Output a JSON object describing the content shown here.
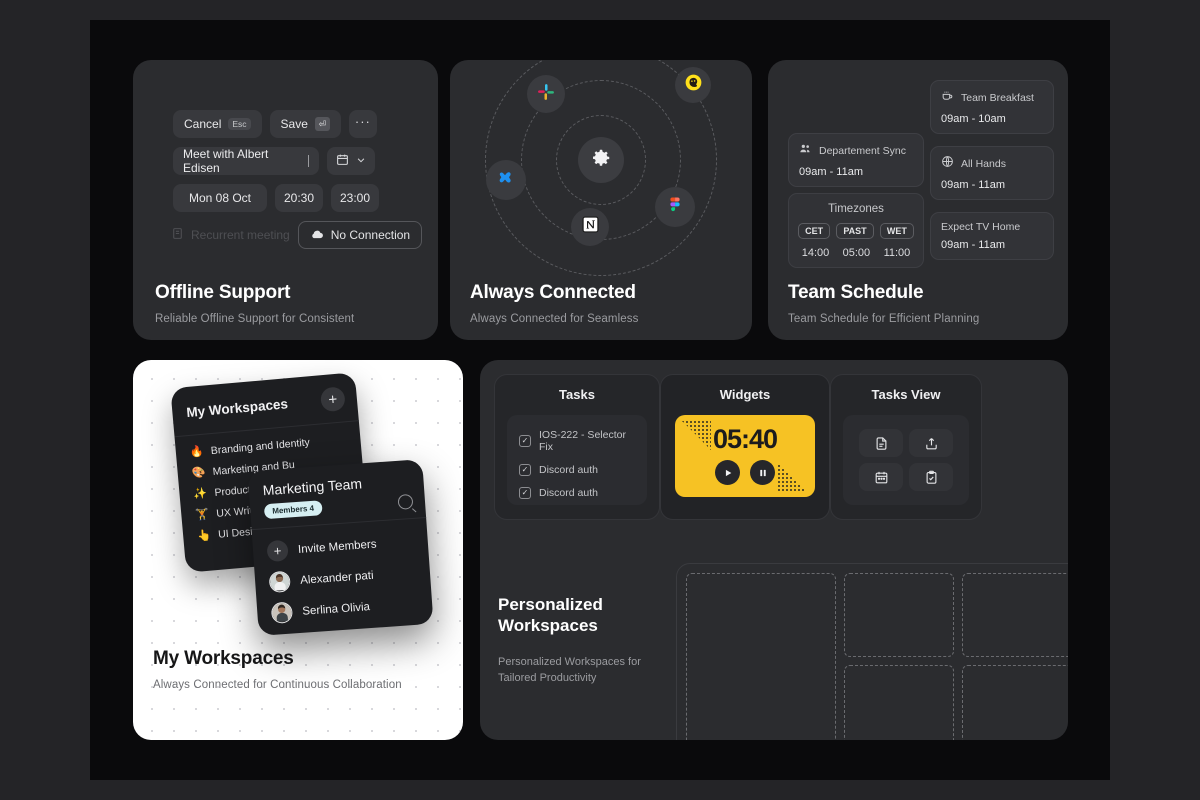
{
  "cards": {
    "offline": {
      "title": "Offline Support",
      "subtitle": "Reliable Offline Support for Consistent",
      "cancel_label": "Cancel",
      "cancel_key": "Esc",
      "save_label": "Save",
      "more_label": "···",
      "meeting_title": "Meet with Albert Edisen",
      "date": "Mon 08 Oct",
      "time_start": "20:30",
      "time_end": "23:00",
      "recurrent_label": "Recurrent meeting",
      "connection_label": "No Connection"
    },
    "connected": {
      "title": "Always Connected",
      "subtitle": "Always Connected for Seamless",
      "integrations": [
        {
          "name": "slack",
          "label": "Slack"
        },
        {
          "name": "mailchimp",
          "label": "Mailchimp"
        },
        {
          "name": "xero",
          "label": "Xero"
        },
        {
          "name": "notion",
          "label": "Notion"
        },
        {
          "name": "figma",
          "label": "Figma"
        },
        {
          "name": "settings",
          "label": "Settings"
        }
      ]
    },
    "schedule": {
      "title": "Team Schedule",
      "subtitle": "Team Schedule for Efficient Planning",
      "events": [
        {
          "name": "Departement Sync",
          "time": "09am - 11am",
          "icon": "users-icon"
        },
        {
          "name": "Team Breakfast",
          "time": "09am - 10am",
          "icon": "coffee-icon"
        },
        {
          "name": "All Hands",
          "time": "09am - 11am",
          "icon": "globe-icon"
        },
        {
          "name": "Expect TV Home",
          "time": "09am - 11am",
          "icon": "none"
        }
      ],
      "timezones": {
        "title": "Timezones",
        "tags": [
          "CET",
          "PAST",
          "WET"
        ],
        "times": [
          "14:00",
          "05:00",
          "11:00"
        ]
      }
    },
    "workspaces": {
      "title": "My Workspaces",
      "subtitle": "Always Connected for Continuous Collaboration",
      "panel_title": "My Workspaces",
      "add_label": "+",
      "items": [
        {
          "emoji": "🔥",
          "label": "Branding and Identity"
        },
        {
          "emoji": "🎨",
          "label": "Marketing and Bu"
        },
        {
          "emoji": "✨",
          "label": "Product Landing"
        },
        {
          "emoji": "🏋️",
          "label": "UX Writing"
        },
        {
          "emoji": "👆",
          "label": "UI Designer"
        }
      ],
      "team": {
        "title": "Marketing Team",
        "badge": "Members 4",
        "invite_label": "Invite Members",
        "invite_plus": "+",
        "members": [
          {
            "name": "Alexander pati"
          },
          {
            "name": "Serlina Olivia"
          }
        ]
      }
    },
    "personalized": {
      "title": "Personalized\nWorkspaces",
      "title_line1": "Personalized",
      "title_line2": "Workspaces",
      "subtitle": "Personalized Workspaces for Tailored Productivity",
      "tasks": {
        "title": "Tasks",
        "items": [
          {
            "label": "IOS-222 - Selector Fix",
            "checked": true
          },
          {
            "label": "Discord auth",
            "checked": true
          },
          {
            "label": "Discord auth",
            "checked": true
          }
        ]
      },
      "widgets": {
        "title": "Widgets",
        "timer": "05:40",
        "play_label": "Play",
        "pause_label": "Pause",
        "accent_color": "#f6c224"
      },
      "tasks_view": {
        "title": "Tasks View",
        "buttons": [
          "document-icon",
          "upload-icon",
          "calendar-icon",
          "clipboard-check-icon"
        ]
      }
    }
  }
}
